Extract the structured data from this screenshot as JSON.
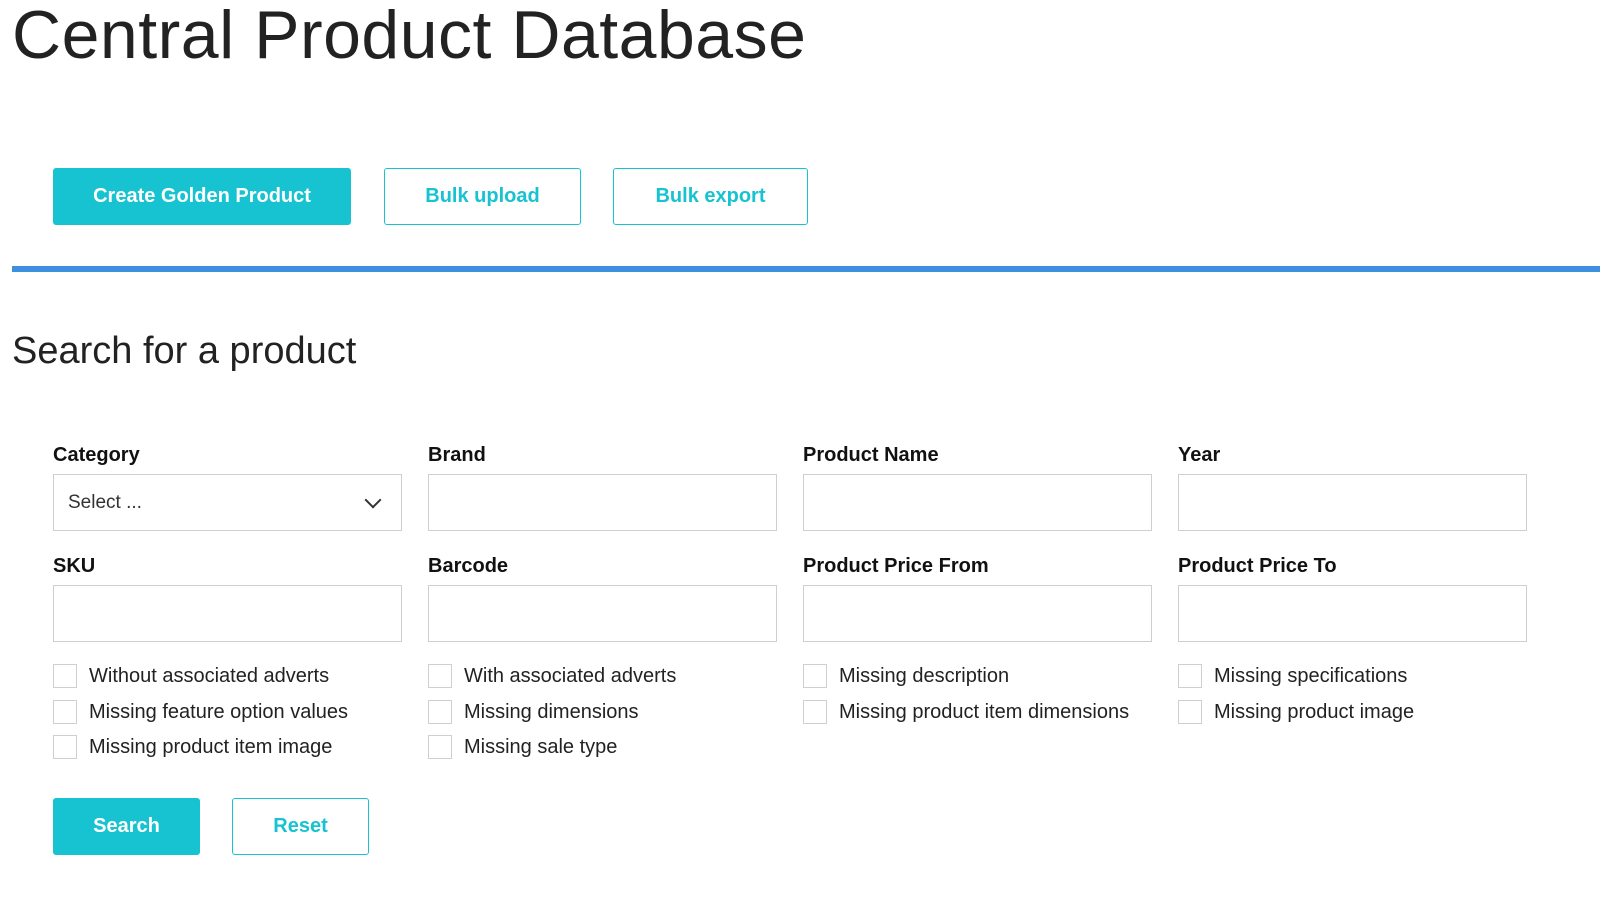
{
  "page": {
    "title": "Central Product Database"
  },
  "toolbar": {
    "create_label": "Create Golden Product",
    "bulk_upload_label": "Bulk upload",
    "bulk_export_label": "Bulk export"
  },
  "search": {
    "title": "Search for a product",
    "fields": {
      "category": {
        "label": "Category",
        "value": "Select ..."
      },
      "brand": {
        "label": "Brand",
        "value": ""
      },
      "product_name": {
        "label": "Product Name",
        "value": ""
      },
      "year": {
        "label": "Year",
        "value": ""
      },
      "sku": {
        "label": "SKU",
        "value": ""
      },
      "barcode": {
        "label": "Barcode",
        "value": ""
      },
      "price_from": {
        "label": "Product Price From",
        "value": ""
      },
      "price_to": {
        "label": "Product Price To",
        "value": ""
      }
    },
    "filters": [
      {
        "label": "Without associated adverts",
        "checked": false
      },
      {
        "label": "With associated adverts",
        "checked": false
      },
      {
        "label": "Missing description",
        "checked": false
      },
      {
        "label": "Missing specifications",
        "checked": false
      },
      {
        "label": "Missing feature option values",
        "checked": false
      },
      {
        "label": "Missing dimensions",
        "checked": false
      },
      {
        "label": "Missing product item dimensions",
        "checked": false
      },
      {
        "label": "Missing product image",
        "checked": false
      },
      {
        "label": "Missing product item image",
        "checked": false
      },
      {
        "label": "Missing sale type",
        "checked": false
      }
    ],
    "search_label": "Search",
    "reset_label": "Reset"
  },
  "colors": {
    "accent": "#17c3d1",
    "divider": "#3f8fdf",
    "border": "#cfcfcf"
  }
}
